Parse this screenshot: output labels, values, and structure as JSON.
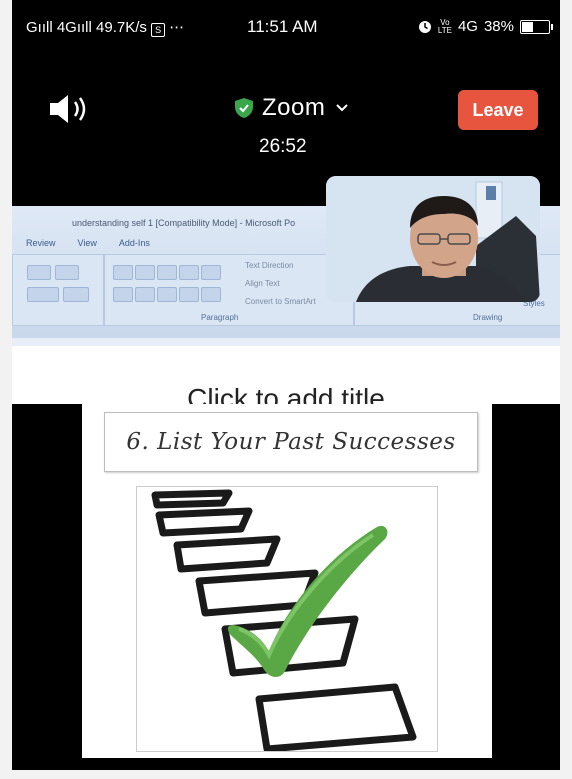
{
  "status_bar": {
    "signal_left": "Gııll 4Gııll",
    "speed": "49.7K/s",
    "overflow": "⋯",
    "time": "11:51 AM",
    "network": "4G",
    "battery_text": "38%",
    "battery_level": 0.38
  },
  "meeting": {
    "app_title": "Zoom",
    "timer": "26:52",
    "leave_label": "Leave",
    "leave_color": "#e8553f",
    "shield_color": "#3aa64c"
  },
  "shared_screen": {
    "window_title": "understanding self 1 [Compatibility Mode] - Microsoft Po",
    "tabs": [
      "Review",
      "View",
      "Add-Ins"
    ],
    "ribbon_items": [
      "Text Direction",
      "Align Text",
      "Convert to SmartArt"
    ],
    "ribbon_groups": [
      "Paragraph",
      "Drawing"
    ],
    "ribbon_styles": "Styles",
    "placeholder_title": "Click to add title",
    "slide_heading": "6. List Your Past Successes"
  }
}
